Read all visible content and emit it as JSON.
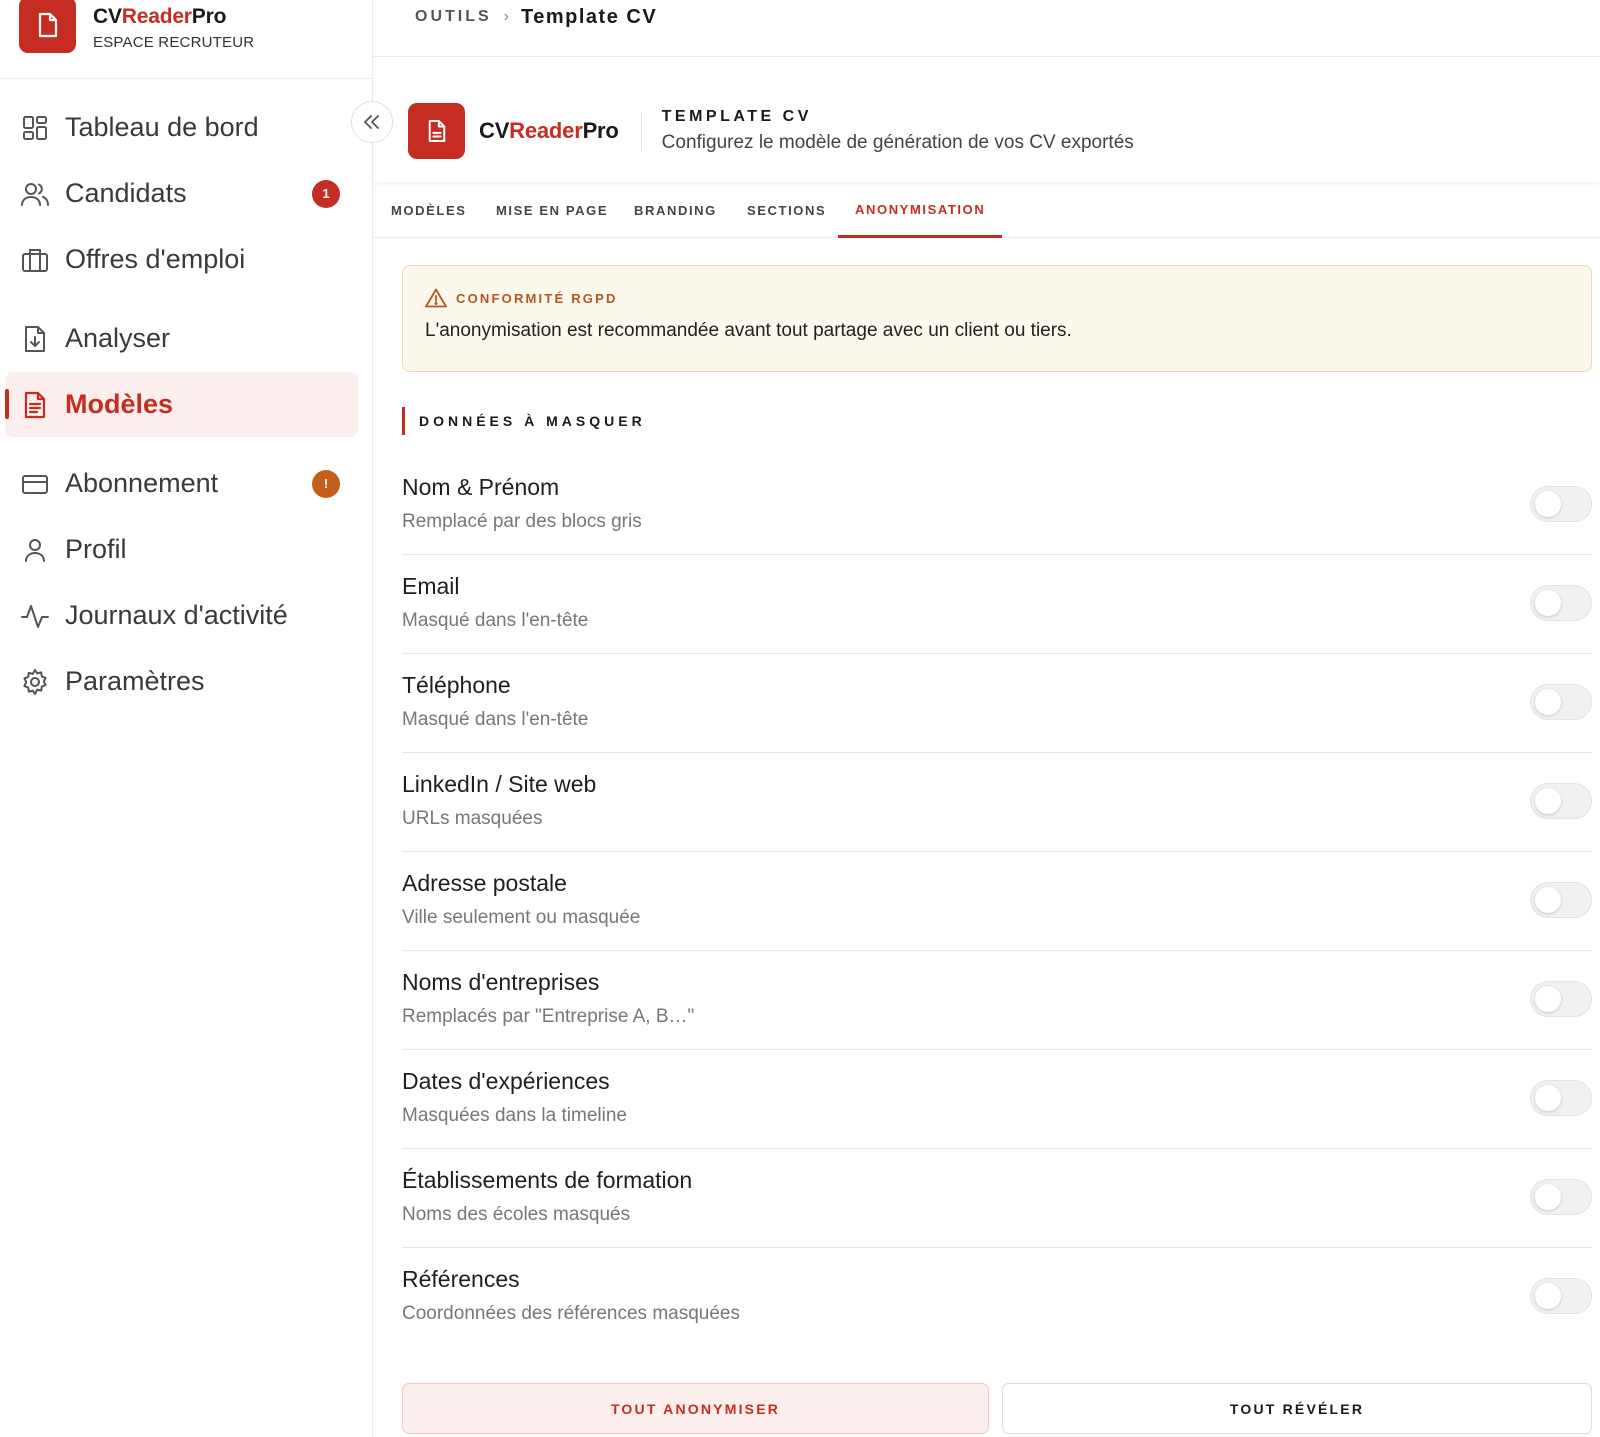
{
  "brand": {
    "name_part1": "CV",
    "name_part2": "Reader",
    "name_part3": "Pro",
    "subtitle": "ESPACE RECRUTEUR",
    "accent_color": "#c62d22"
  },
  "sidebar": {
    "items": [
      {
        "label": "Tableau de bord",
        "icon": "dashboard-grid-icon"
      },
      {
        "label": "Candidats",
        "icon": "users-icon",
        "badge": "1",
        "badge_color": "#c62d22"
      },
      {
        "label": "Offres d'emploi",
        "icon": "briefcase-icon"
      },
      {
        "label": "Analyser",
        "icon": "file-download-icon"
      },
      {
        "label": "Modèles",
        "icon": "document-icon",
        "active": true
      },
      {
        "label": "Abonnement",
        "icon": "credit-card-icon",
        "badge": "!",
        "badge_color": "#c25f1a"
      },
      {
        "label": "Profil",
        "icon": "user-icon"
      },
      {
        "label": "Journaux d'activité",
        "icon": "activity-icon"
      },
      {
        "label": "Paramètres",
        "icon": "gear-icon"
      }
    ],
    "collapse_icon": "double-chevron-left-icon"
  },
  "breadcrumb": {
    "parent": "OUTILS",
    "separator": "›",
    "current": "Template CV"
  },
  "header": {
    "title": "TEMPLATE CV",
    "subtitle": "Configurez le modèle de génération de vos CV exportés"
  },
  "tabs": [
    {
      "label": "MODÈLES"
    },
    {
      "label": "MISE EN PAGE"
    },
    {
      "label": "BRANDING"
    },
    {
      "label": "SECTIONS"
    },
    {
      "label": "ANONYMISATION",
      "active": true
    }
  ],
  "alert": {
    "icon": "warning-triangle-icon",
    "title": "CONFORMITÉ RGPD",
    "text": "L'anonymisation est recommandée avant tout partage avec un client ou tiers."
  },
  "section": {
    "title": "DONNÉES À MASQUER"
  },
  "fields": [
    {
      "title": "Nom & Prénom",
      "description": "Remplacé par des blocs gris",
      "enabled": false
    },
    {
      "title": "Email",
      "description": "Masqué dans l'en-tête",
      "enabled": false
    },
    {
      "title": "Téléphone",
      "description": "Masqué dans l'en-tête",
      "enabled": false
    },
    {
      "title": "LinkedIn / Site web",
      "description": "URLs masquées",
      "enabled": false
    },
    {
      "title": "Adresse postale",
      "description": "Ville seulement ou masquée",
      "enabled": false
    },
    {
      "title": "Noms d'entreprises",
      "description": "Remplacés par \"Entreprise A, B…\"",
      "enabled": false
    },
    {
      "title": "Dates d'expériences",
      "description": "Masquées dans la timeline",
      "enabled": false
    },
    {
      "title": "Établissements de formation",
      "description": "Noms des écoles masqués",
      "enabled": false
    },
    {
      "title": "Références",
      "description": "Coordonnées des références masquées",
      "enabled": false
    }
  ],
  "actions": {
    "anonymize_all": "TOUT ANONYMISER",
    "reveal_all": "TOUT RÉVÉLER"
  }
}
